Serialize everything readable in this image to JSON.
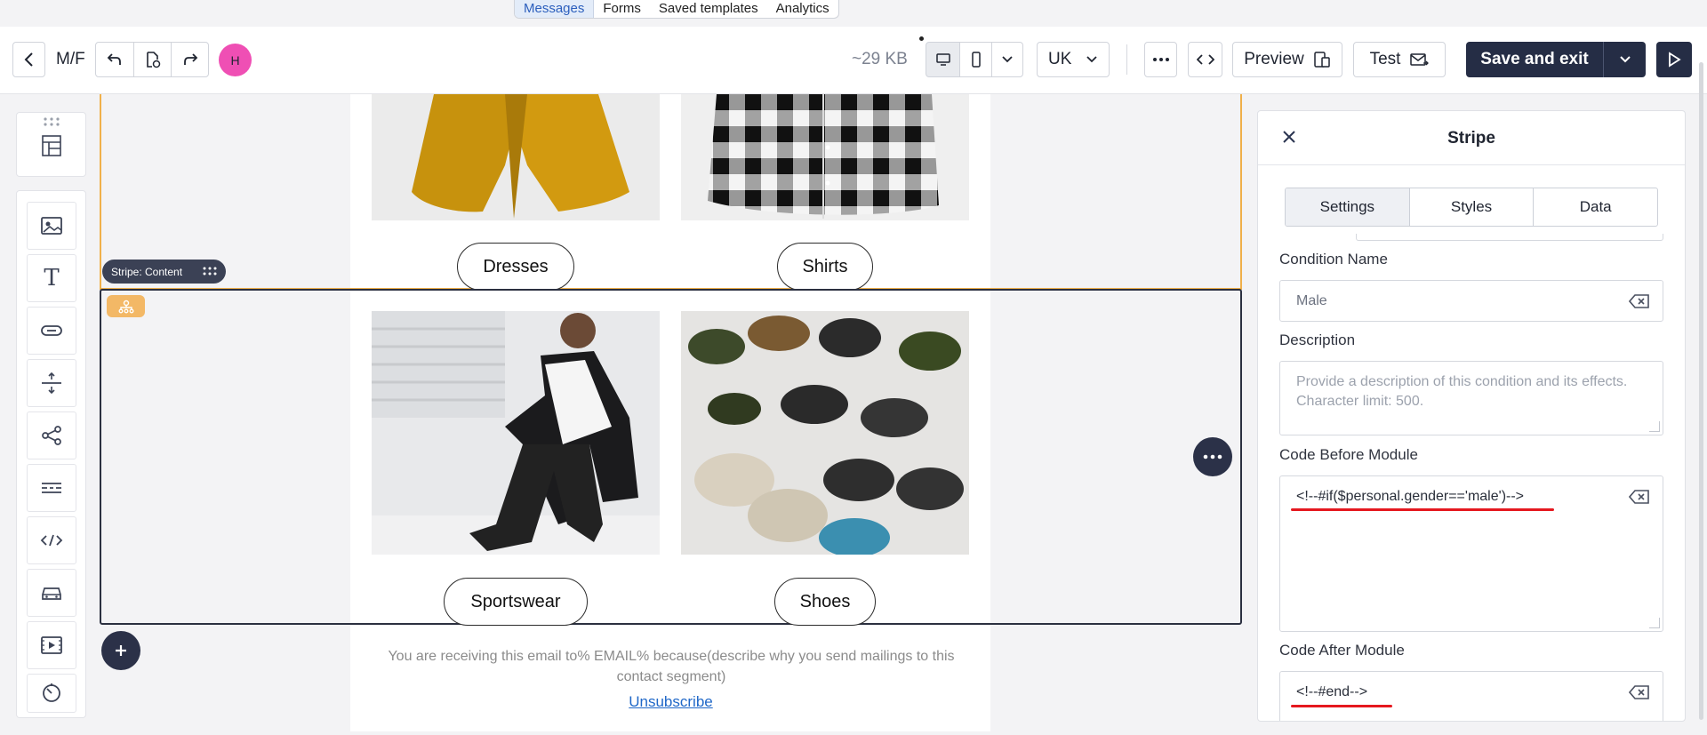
{
  "nav_tabs": [
    "Messages",
    "Forms",
    "Saved templates",
    "Analytics"
  ],
  "toolbar": {
    "message_name": "M/F",
    "avatar_initial": "H",
    "size": "~29 KB",
    "language": "UK",
    "preview_label": "Preview",
    "test_label": "Test",
    "save_label": "Save and exit"
  },
  "canvas": {
    "categories_top": [
      "Dresses",
      "Shirts"
    ],
    "categories_bottom": [
      "Sportswear",
      "Shoes"
    ],
    "stripe_tag": "Stripe: Content",
    "footer_text": "You are receiving this email to% EMAIL% because(describe why you send mailings to this contact segment)",
    "unsubscribe": "Unsubscribe"
  },
  "panel": {
    "title": "Stripe",
    "tabs": [
      "Settings",
      "Styles",
      "Data"
    ],
    "condition_name_label": "Condition Name",
    "condition_name_value": "Male",
    "description_label": "Description",
    "description_placeholder": "Provide a description of this condition and its effects. Character limit: 500.",
    "code_before_label": "Code Before Module",
    "code_before_value": "<!--#if($personal.gender=='male')-->",
    "code_after_label": "Code After Module",
    "code_after_value": "<!--#end-->"
  },
  "colors": {
    "accent": "#252d45",
    "avatar": "#ef4fb4",
    "selection_border": "#f0b04a",
    "annotation": "#e5181f"
  }
}
